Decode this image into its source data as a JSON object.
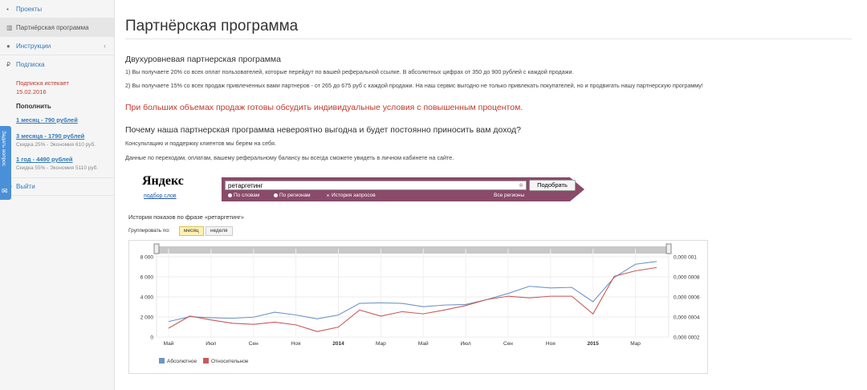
{
  "sidebar": {
    "items": [
      {
        "label": "Проекты",
        "icon": "folder-icon"
      },
      {
        "label": "Партнёрская программа",
        "icon": "bar-chart-icon"
      },
      {
        "label": "Инструкции",
        "icon": "info-icon"
      },
      {
        "label": "Подписка",
        "icon": "ruble-icon"
      },
      {
        "label": "Выйти",
        "icon": "logout-icon"
      }
    ],
    "subscription": {
      "expire_label": "Подписка истекает",
      "expire_date": "15.02.2016",
      "topup_label": "Пополнить",
      "plans": [
        {
          "link": "1 месяц - 790 рублей",
          "note": ""
        },
        {
          "link": "3 месяца - 1790 рублей",
          "note": "Скидка 25% - Экономия 610 руб."
        },
        {
          "link": "1 год - 4490 рублей",
          "note": "Скидка 55% - Экономия 5110 руб."
        }
      ]
    },
    "feedback_tab": "Задать вопрос"
  },
  "main": {
    "title": "Партнёрская программа",
    "section1_title": "Двухуровневая партнерская программа",
    "p1": "1) Вы получаете 20% со всех оплат пользователей, которые перейдут по вашей реферальной ссылке. В абсолютных цифрах от 350 до 900 рублей с каждой продажи.",
    "p2": "2) Вы получаете 15% со всех продаж привлеченных вами партнеров - от 265 до 675 руб с каждой продажи. На наш сервис выгодно не только привлекать покупателей, но и продвигать нашу партнерскую программу!",
    "red_note": "При больших объемах продаж готовы обсудить индивидуальные условия с повышенным процентом.",
    "section2_title": "Почему наша партнерская программа невероятно выгодна и будет постоянно приносить вам доход?",
    "p3": "Консультацию и поддержку клиентов мы берем на себя.",
    "p4": "Данные по переходам, оплатам, вашему реферальному балансу вы всегда сможете увидеть в личном кабинете на сайте."
  },
  "yandex": {
    "logo": "Яндекс",
    "logo_sub": "подбор слов",
    "query": "ретаргетинг",
    "clear_glyph": "⊗",
    "button": "Подобрать",
    "radios": [
      "По словам",
      "По регионам",
      "История запросов"
    ],
    "regions": "Все регионы",
    "history_title": "История показов по фразе «ретаргетинг»",
    "group_label": "Группировать по:",
    "group_options": [
      "месяц",
      "неделя"
    ]
  },
  "chart_data": {
    "type": "line",
    "x_tick_labels": [
      "Май",
      "Июл",
      "Сен",
      "Ноя",
      "2014",
      "Мар",
      "Май",
      "Июл",
      "Сен",
      "Ноя",
      "2015",
      "Мар"
    ],
    "y_left_ticks": [
      "8 000",
      "6 000",
      "4 000",
      "2 000",
      "0"
    ],
    "y_right_ticks": [
      "0,000 001",
      "0,000 0008",
      "0,000 0006",
      "0,000 0004",
      "0,000 0002"
    ],
    "ylim_left": [
      0,
      8000
    ],
    "series": [
      {
        "name": "Абсолютное",
        "color": "#6f94c8",
        "values": [
          1400,
          1850,
          1750,
          1700,
          1800,
          2250,
          2000,
          1650,
          2000,
          3050,
          3100,
          3050,
          2750,
          2900,
          2950,
          3400,
          3950,
          4600,
          4450,
          4500,
          3200,
          5400,
          6600,
          6850
        ]
      },
      {
        "name": "Относительное",
        "color": "#c85a5a",
        "values": [
          800,
          1900,
          1550,
          1250,
          1150,
          1350,
          1100,
          500,
          900,
          2450,
          1900,
          2300,
          2100,
          2450,
          2850,
          3400,
          3700,
          3550,
          3700,
          3700,
          2100,
          5500,
          6000,
          6300
        ]
      }
    ]
  }
}
